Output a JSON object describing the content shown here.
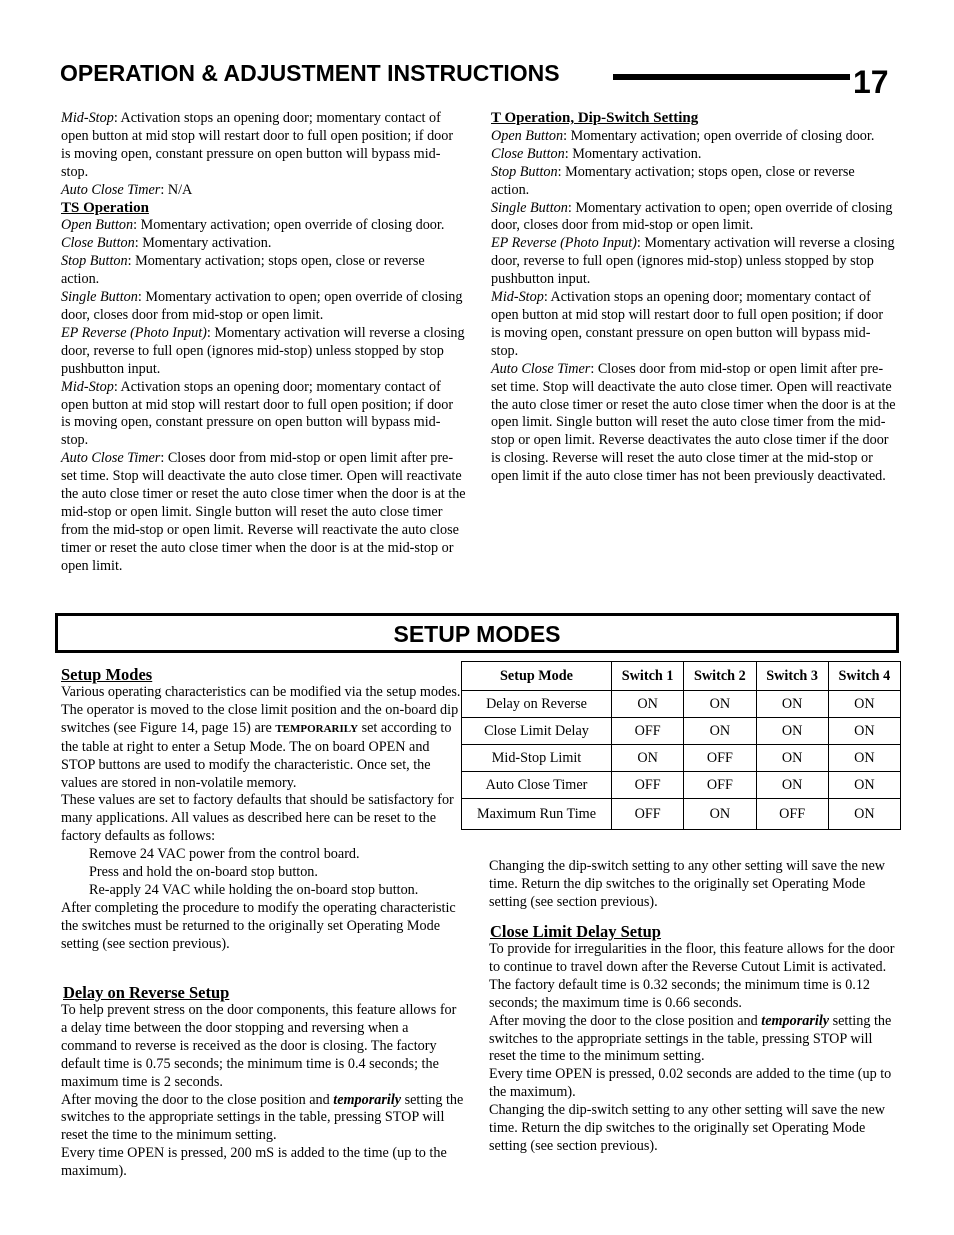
{
  "header": {
    "title": "OPERATION & ADJUSTMENT INSTRUCTIONS",
    "page_number": "17"
  },
  "left_column": {
    "intro": {
      "mid_stop_label": "Mid-Stop",
      "mid_stop_text": ": Activation stops an opening door; momentary contact of open button at mid stop will restart door to full open position; if door is moving open, constant pressure on open button will bypass mid-stop.",
      "auto_close_label": "Auto Close Timer",
      "auto_close_text": ": N/A"
    },
    "ts_operation": {
      "heading": "TS Operation",
      "items": [
        {
          "label": "Open Button",
          "text": ": Momentary activation; open override of closing door."
        },
        {
          "label": "Close Button",
          "text": ": Momentary activation."
        },
        {
          "label": "Stop Button",
          "text": ": Momentary activation; stops open, close or reverse action."
        },
        {
          "label": "Single Button",
          "text": ": Momentary activation to open; open override of closing door, closes door from mid-stop or open limit."
        },
        {
          "label": "EP Reverse (Photo Input)",
          "text": ": Momentary activation will reverse a closing door, reverse to full open (ignores mid-stop) unless stopped by stop pushbutton input."
        },
        {
          "label": "Mid-Stop",
          "text": ": Activation stops an opening door; momentary contact of open button at mid stop will restart door to full open position; if door is moving open, constant pressure on open button will bypass mid-stop."
        },
        {
          "label": "Auto Close Timer",
          "text": ": Closes door from mid-stop or open limit after pre-set time. Stop will deactivate the auto close timer. Open will reactivate the auto close timer or reset the auto close timer when the door is at the mid-stop or open limit. Single button will reset the auto close timer from the mid-stop or open limit. Reverse will reactivate the auto close timer or reset the auto close timer when the door is at the mid-stop or open limit."
        }
      ]
    }
  },
  "right_column": {
    "t_operation": {
      "heading": "T Operation, Dip-Switch Setting",
      "items": [
        {
          "label": "Open Button",
          "text": ": Momentary activation; open override of closing door."
        },
        {
          "label": "Close Button",
          "text": ": Momentary activation."
        },
        {
          "label": "Stop Button",
          "text": ": Momentary activation; stops open, close or reverse action."
        },
        {
          "label": "Single Button",
          "text": ": Momentary activation to open; open override of closing door, closes door from mid-stop or open limit."
        },
        {
          "label": "EP Reverse (Photo Input)",
          "text": ": Momentary activation will reverse a closing door, reverse to full open (ignores mid-stop) unless stopped by stop pushbutton input."
        },
        {
          "label": "Mid-Stop",
          "text": ": Activation stops an opening door; momentary contact of open button at mid stop will restart door to full open position; if door is moving open, constant pressure on open button will bypass mid-stop."
        },
        {
          "label": "Auto Close Timer",
          "text": ": Closes door from mid-stop or open limit after pre-set time. Stop will deactivate the auto close timer. Open will reactivate the auto close timer or reset the auto close timer when the door is at the open limit. Single button will reset the auto close timer from the mid-stop or open limit. Reverse deactivates the auto close timer if the door is closing. Reverse will reset the auto close timer at the mid-stop or open limit if the auto close timer has not been previously deactivated."
        }
      ]
    }
  },
  "setup_banner": "SETUP MODES",
  "setup_modes": {
    "heading": "Setup Modes",
    "para1_a": "Various operating characteristics can be modified via the setup modes. The operator is moved to the close limit position and the on-board dip switches (see Figure 14, page 15) are ",
    "para1_emph": "TEMPORARILY",
    "para1_b": " set according to the table at right to enter a Setup Mode. The on board OPEN and STOP buttons are used to modify the characteristic. Once set, the values are stored in non-volatile memory.",
    "para2": "These values are set to factory defaults that should be satisfactory for many applications. All values as described here can be reset to the factory defaults as follows:",
    "steps": [
      "Remove 24 VAC power from the control board.",
      "Press and hold the on-board stop button.",
      "Re-apply 24 VAC while holding the on-board stop button."
    ],
    "para3": "After completing the procedure to modify the operating characteristic the switches must be returned to the originally set Operating Mode setting (see section previous)."
  },
  "delay_on_reverse": {
    "heading": "Delay on Reverse Setup",
    "para1": "To help prevent stress on the door components, this feature allows for a delay time between the door stopping and reversing when a command to reverse is received as the door is closing. The factory default time is 0.75 seconds; the minimum time is 0.4 seconds; the maximum time is 2 seconds.",
    "para2_a": "After moving the door to the close position and ",
    "para2_emph": "temporarily",
    "para2_b": " setting the switches to the appropriate settings in the table, pressing STOP will reset the time to the minimum setting.",
    "para3": "Every time OPEN is pressed, 200 mS is added to the time (up to the maximum)."
  },
  "table": {
    "headers": [
      "Setup Mode",
      "Switch 1",
      "Switch 2",
      "Switch 3",
      "Switch 4"
    ],
    "rows": [
      [
        "Delay on Reverse",
        "ON",
        "ON",
        "ON",
        "ON"
      ],
      [
        "Close Limit Delay",
        "OFF",
        "ON",
        "ON",
        "ON"
      ],
      [
        "Mid-Stop Limit",
        "ON",
        "OFF",
        "ON",
        "ON"
      ],
      [
        "Auto Close Timer",
        "OFF",
        "OFF",
        "ON",
        "ON"
      ],
      [
        "Maximum Run Time",
        "OFF",
        "ON",
        "OFF",
        "ON"
      ]
    ]
  },
  "table_note": "Changing the dip-switch setting to any other setting will save the new time.  Return the dip switches to the originally set Operating Mode setting (see section previous).",
  "close_limit_delay": {
    "heading": "Close Limit Delay Setup",
    "para1": "To provide for irregularities in the floor, this feature allows for the door to continue to travel down after the Reverse Cutout Limit is activated.  The factory default time is 0.32 seconds; the minimum time is 0.12 seconds; the maximum time is 0.66 seconds.",
    "para2_a": "After moving the door to the close position and ",
    "para2_emph": "temporarily",
    "para2_b": " setting the switches to the appropriate settings in the table, pressing STOP will reset the time to the minimum setting.",
    "para3": "Every time OPEN is pressed, 0.02 seconds are added to the time (up to the maximum).",
    "para4": "Changing the dip-switch setting to any other setting will save the new time.  Return the dip switches to the originally set Operating Mode setting (see section previous)."
  }
}
